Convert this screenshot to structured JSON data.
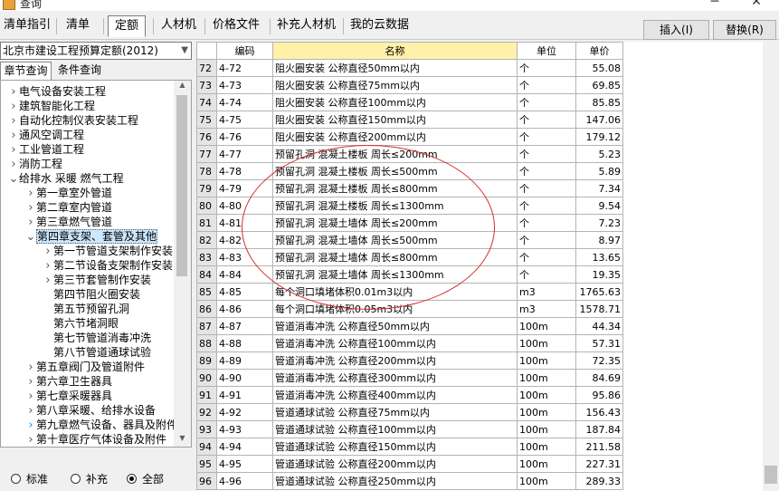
{
  "window": {
    "title": "查询"
  },
  "tabs": [
    "清单指引",
    "清单",
    "定额",
    "人材机",
    "价格文件",
    "补充人材机",
    "我的云数据"
  ],
  "selected_tab": "定额",
  "actions": {
    "insert": "插入(I)",
    "replace": "替换(R)"
  },
  "library": "北京市建设工程预算定额(2012)",
  "subtabs": [
    "章节查询",
    "条件查询"
  ],
  "tree": [
    {
      "label": "电气设备安装工程",
      "level": 0,
      "arrow": ">"
    },
    {
      "label": "建筑智能化工程",
      "level": 0,
      "arrow": ">"
    },
    {
      "label": "自动化控制仪表安装工程",
      "level": 0,
      "arrow": ">"
    },
    {
      "label": "通风空调工程",
      "level": 0,
      "arrow": ">"
    },
    {
      "label": "工业管道工程",
      "level": 0,
      "arrow": ">"
    },
    {
      "label": "消防工程",
      "level": 0,
      "arrow": ">"
    },
    {
      "label": "给排水 采暖 燃气工程",
      "level": 0,
      "arrow": "v"
    },
    {
      "label": "第一章室外管道",
      "level": 1,
      "arrow": ">"
    },
    {
      "label": "第二章室内管道",
      "level": 1,
      "arrow": ">"
    },
    {
      "label": "第三章燃气管道",
      "level": 1,
      "arrow": ">"
    },
    {
      "label": "第四章支架、套管及其他",
      "level": 1,
      "arrow": "v",
      "highlight": true
    },
    {
      "label": "第一节管道支架制作安装",
      "level": 2,
      "arrow": ">"
    },
    {
      "label": "第二节设备支架制作安装",
      "level": 2,
      "arrow": ">"
    },
    {
      "label": "第三节套管制作安装",
      "level": 2,
      "arrow": ">"
    },
    {
      "label": "第四节阻火圈安装",
      "level": 2,
      "arrow": ""
    },
    {
      "label": "第五节预留孔洞",
      "level": 2,
      "arrow": ""
    },
    {
      "label": "第六节堵洞眼",
      "level": 2,
      "arrow": ""
    },
    {
      "label": "第七节管道消毒冲洗",
      "level": 2,
      "arrow": ""
    },
    {
      "label": "第八节管道通球试验",
      "level": 2,
      "arrow": ""
    },
    {
      "label": "第五章阀门及管道附件",
      "level": 1,
      "arrow": ">"
    },
    {
      "label": "第六章卫生器具",
      "level": 1,
      "arrow": ">"
    },
    {
      "label": "第七章采暖器具",
      "level": 1,
      "arrow": ">"
    },
    {
      "label": "第八章采暖、给排水设备",
      "level": 1,
      "arrow": ">"
    },
    {
      "label": "第九章燃气设备、器具及附件",
      "level": 1,
      "arrow": ">",
      "blue": true
    },
    {
      "label": "第十章医疗气体设备及附件",
      "level": 1,
      "arrow": ">"
    }
  ],
  "filters": {
    "options": [
      "标准",
      "补充",
      "全部"
    ],
    "selected": "全部"
  },
  "columns": {
    "code": "编码",
    "name": "名称",
    "unit": "单位",
    "price": "单价"
  },
  "rows": [
    [
      "72",
      "4-72",
      "阻火圈安装 公称直径50mm以内",
      "个",
      "55.08"
    ],
    [
      "73",
      "4-73",
      "阻火圈安装 公称直径75mm以内",
      "个",
      "69.85"
    ],
    [
      "74",
      "4-74",
      "阻火圈安装 公称直径100mm以内",
      "个",
      "85.85"
    ],
    [
      "75",
      "4-75",
      "阻火圈安装 公称直径150mm以内",
      "个",
      "147.06"
    ],
    [
      "76",
      "4-76",
      "阻火圈安装 公称直径200mm以内",
      "个",
      "179.12"
    ],
    [
      "77",
      "4-77",
      "预留孔洞 混凝土楼板 周长≤200mm",
      "个",
      "5.23"
    ],
    [
      "78",
      "4-78",
      "预留孔洞 混凝土楼板 周长≤500mm",
      "个",
      "5.89"
    ],
    [
      "79",
      "4-79",
      "预留孔洞 混凝土楼板 周长≤800mm",
      "个",
      "7.34"
    ],
    [
      "80",
      "4-80",
      "预留孔洞 混凝土楼板 周长≤1300mm",
      "个",
      "9.54"
    ],
    [
      "81",
      "4-81",
      "预留孔洞 混凝土墙体 周长≤200mm",
      "个",
      "7.23"
    ],
    [
      "82",
      "4-82",
      "预留孔洞 混凝土墙体 周长≤500mm",
      "个",
      "8.97"
    ],
    [
      "83",
      "4-83",
      "预留孔洞 混凝土墙体 周长≤800mm",
      "个",
      "13.65"
    ],
    [
      "84",
      "4-84",
      "预留孔洞 混凝土墙体 周长≤1300mm",
      "个",
      "19.35"
    ],
    [
      "85",
      "4-85",
      "每个洞口填堵体积0.01m3以内",
      "m3",
      "1765.63"
    ],
    [
      "86",
      "4-86",
      "每个洞口填堵体积0.05m3以内",
      "m3",
      "1578.71"
    ],
    [
      "87",
      "4-87",
      "管道消毒冲洗 公称直径50mm以内",
      "100m",
      "44.34"
    ],
    [
      "88",
      "4-88",
      "管道消毒冲洗 公称直径100mm以内",
      "100m",
      "57.31"
    ],
    [
      "89",
      "4-89",
      "管道消毒冲洗 公称直径200mm以内",
      "100m",
      "72.35"
    ],
    [
      "90",
      "4-90",
      "管道消毒冲洗 公称直径300mm以内",
      "100m",
      "84.69"
    ],
    [
      "91",
      "4-91",
      "管道消毒冲洗 公称直径400mm以内",
      "100m",
      "95.86"
    ],
    [
      "92",
      "4-92",
      "管道通球试验 公称直径75mm以内",
      "100m",
      "156.43"
    ],
    [
      "93",
      "4-93",
      "管道通球试验 公称直径100mm以内",
      "100m",
      "187.84"
    ],
    [
      "94",
      "4-94",
      "管道通球试验 公称直径150mm以内",
      "100m",
      "211.58"
    ],
    [
      "95",
      "4-95",
      "管道通球试验 公称直径200mm以内",
      "100m",
      "227.31"
    ],
    [
      "96",
      "4-96",
      "管道通球试验 公称直径250mm以内",
      "100m",
      "289.33"
    ]
  ],
  "annotation_color": "#d62f2f"
}
